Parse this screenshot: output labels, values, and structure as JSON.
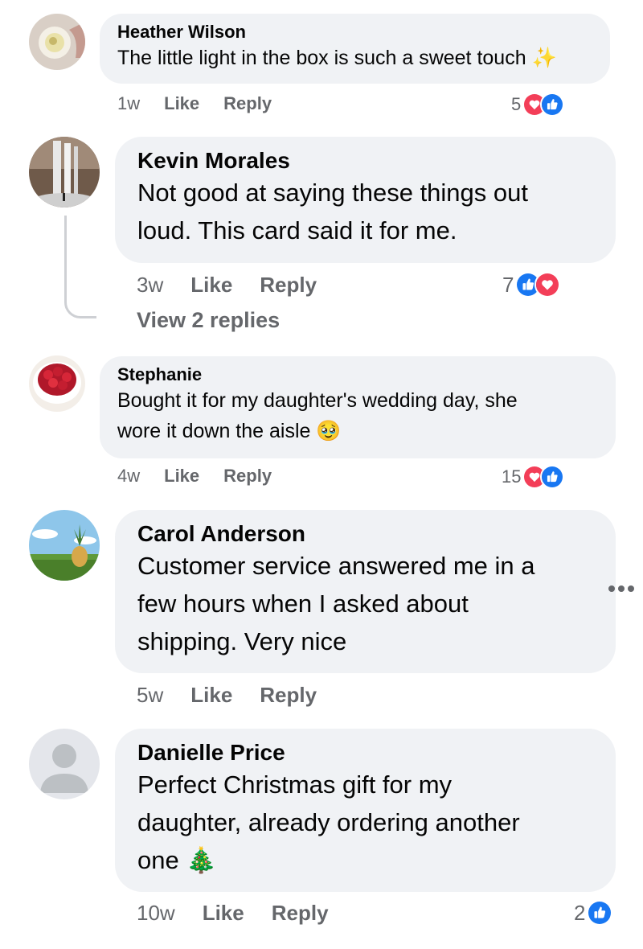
{
  "comments": [
    {
      "name": "Heather Wilson",
      "text": "The little light in the box is such a sweet touch",
      "emoji": "✨",
      "time": "1w",
      "like": "Like",
      "reply": "Reply",
      "reaction_count": "5",
      "reactions": [
        "love-icon",
        "like-icon"
      ]
    },
    {
      "name": "Kevin Morales",
      "text_lines": [
        "Not good at saying these things out",
        "loud. This card said it for me."
      ],
      "time": "3w",
      "like": "Like",
      "reply": "Reply",
      "reaction_count": "7",
      "reactions": [
        "like-icon",
        "love-icon"
      ],
      "view_replies": "View 2 replies"
    },
    {
      "name": "Stephanie",
      "text_lines": [
        "Bought it for my daughter's wedding day, she",
        "wore it down the aisle"
      ],
      "emoji": "🥹",
      "time": "4w",
      "like": "Like",
      "reply": "Reply",
      "reaction_count": "15",
      "reactions": [
        "love-icon",
        "like-icon"
      ]
    },
    {
      "name": "Carol Anderson",
      "text_lines": [
        "Customer service answered me in a",
        "few hours when I asked about",
        "shipping. Very nice"
      ],
      "time": "5w",
      "like": "Like",
      "reply": "Reply"
    },
    {
      "name": "Danielle Price",
      "text_lines": [
        "Perfect Christmas gift for my",
        "daughter, already ordering another",
        "one"
      ],
      "emoji": "🎄",
      "time": "10w",
      "like": "Like",
      "reply": "Reply",
      "reaction_count": "2",
      "reactions": [
        "like-icon"
      ]
    }
  ],
  "colors": {
    "bubble": "#f0f2f5",
    "meta_text": "#65676b",
    "like_blue": "#1877f2",
    "love_red": "#f33e58",
    "thread_line": "#ced0d4"
  }
}
